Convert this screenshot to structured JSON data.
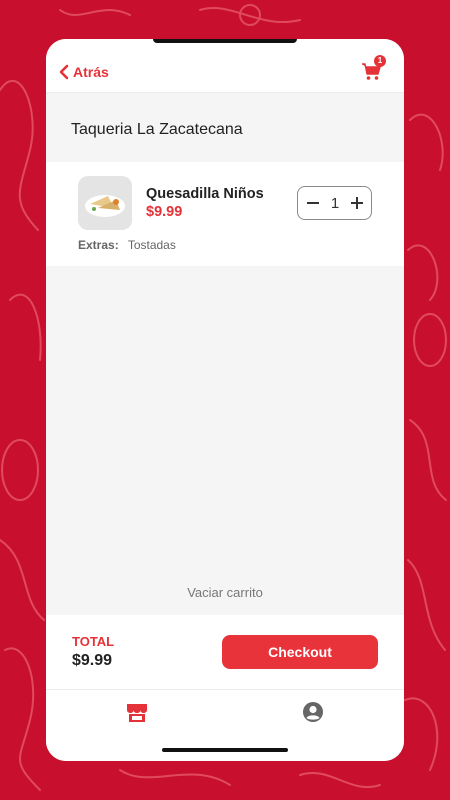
{
  "header": {
    "back_label": "Atrás",
    "cart_count": "1"
  },
  "restaurant_name": "Taqueria La Zacatecana",
  "cart_items": [
    {
      "name": "Quesadilla Niños",
      "price": "$9.99",
      "quantity": "1",
      "extras_label": "Extras:",
      "extras_value": "Tostadas",
      "image_icon": "quesadilla-plate"
    }
  ],
  "empty_cart_label": "Vaciar carrito",
  "footer": {
    "total_label": "TOTAL",
    "total_value": "$9.99",
    "checkout_label": "Checkout"
  },
  "tabs": [
    {
      "icon": "store-icon",
      "active": true
    },
    {
      "icon": "user-icon",
      "active": false
    }
  ],
  "colors": {
    "brand_red": "#c8102e",
    "accent_red": "#e53238",
    "background": "#f5f5f5"
  }
}
